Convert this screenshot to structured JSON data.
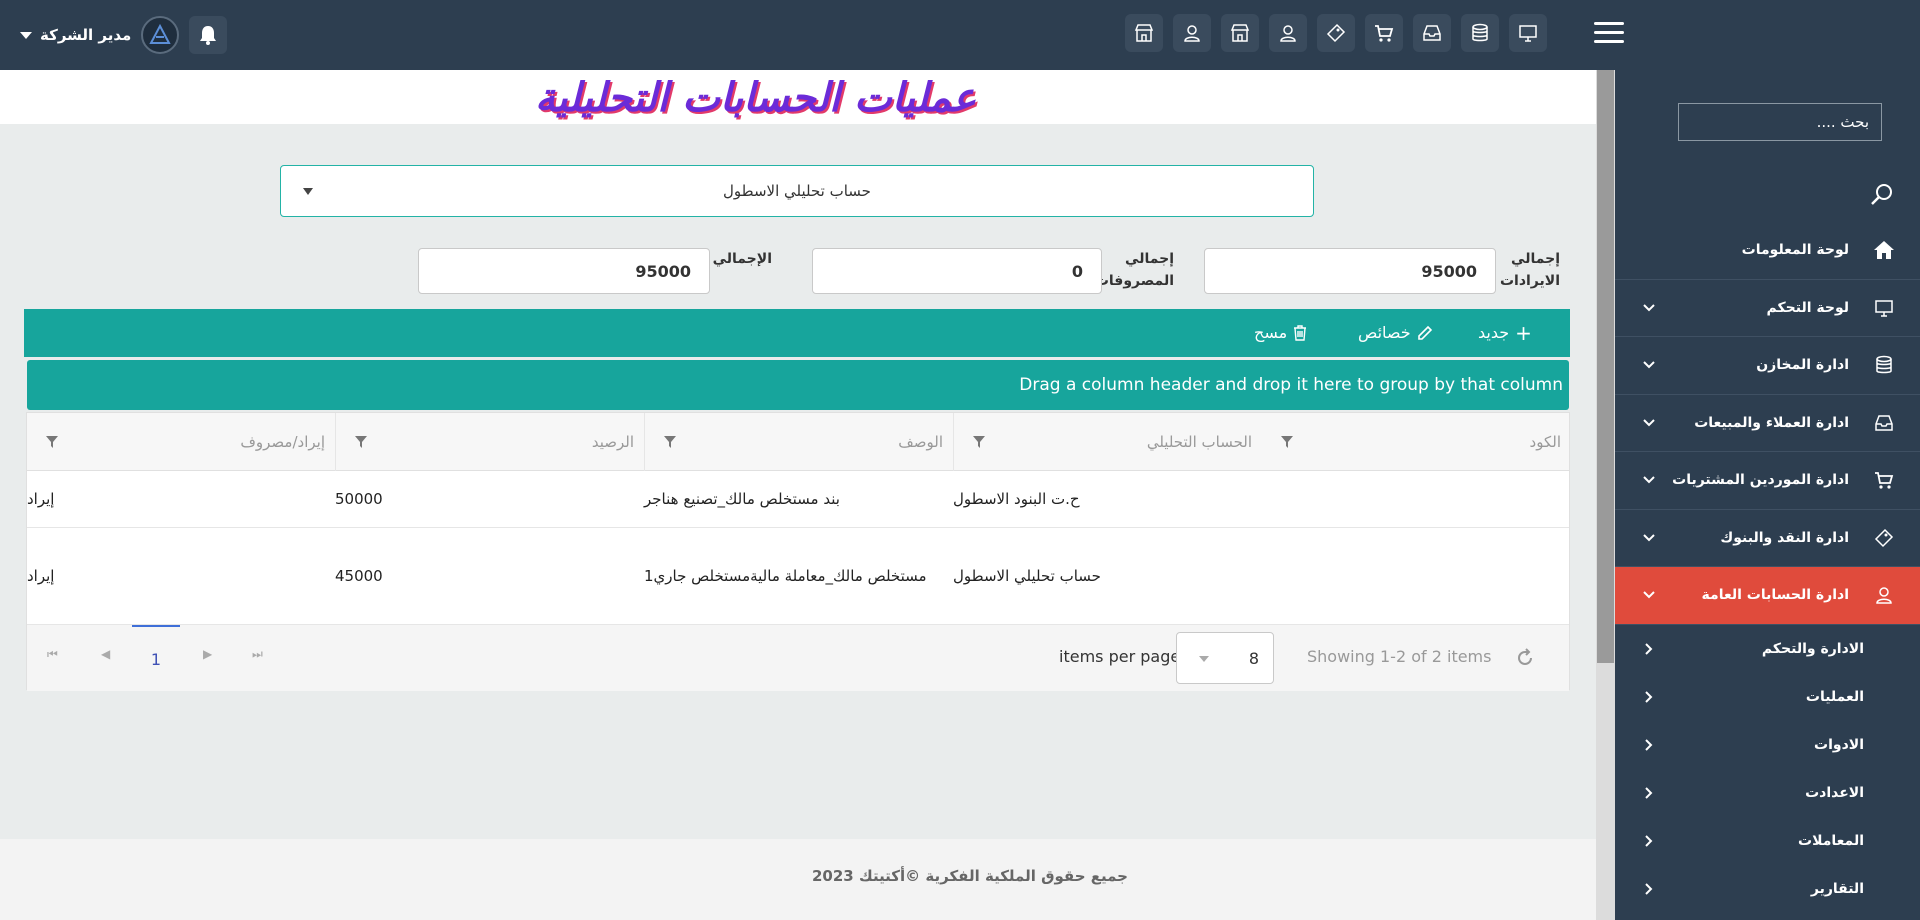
{
  "header": {
    "user_name": "مدير الشركة",
    "icons": [
      "monitor-icon",
      "database-icon",
      "inbox-icon",
      "cart-icon",
      "ticket-icon",
      "user-icon",
      "store-icon",
      "user-icon",
      "store-icon"
    ]
  },
  "sidebar": {
    "search_placeholder": "بحث ....",
    "items": [
      {
        "label": "لوحة المعلومات",
        "icon": "home-icon",
        "expandable": false
      },
      {
        "label": "لوحة التحكم",
        "icon": "monitor-icon",
        "expandable": true
      },
      {
        "label": "ادارة المخازن",
        "icon": "database-icon",
        "expandable": true
      },
      {
        "label": "ادارة العملاء والمبيعات",
        "icon": "inbox-icon",
        "expandable": true
      },
      {
        "label": "ادارة الموردين المشتريات",
        "icon": "cart-icon",
        "expandable": true
      },
      {
        "label": "ادارة النقد والبنوك",
        "icon": "ticket-icon",
        "expandable": true
      },
      {
        "label": "ادارة الحسابات العامة",
        "icon": "user-icon",
        "expandable": true,
        "active": true
      }
    ],
    "subitems": [
      {
        "label": "الادارة والتحكم"
      },
      {
        "label": "العمليات"
      },
      {
        "label": "الادوات"
      },
      {
        "label": "الاعدادت"
      },
      {
        "label": "المعاملات"
      },
      {
        "label": "التقارير"
      }
    ],
    "active_color": "#e04b3c"
  },
  "page": {
    "title": "عمليات الحسابات التحليلية",
    "selected_account": "حساب تحليلي الاسطول"
  },
  "totals": {
    "revenue_label": "إجمالي الايرادات",
    "revenue_value": "95000",
    "expenses_label": "إجمالي المصروفات",
    "expenses_value": "0",
    "total_label": "الإجمالي",
    "total_value": "95000"
  },
  "toolbar": {
    "new_label": "جديد",
    "properties_label": "خصائص",
    "delete_label": "مسح",
    "accent_color": "#17a59c"
  },
  "grid": {
    "group_hint": "Drag a column header and drop it here to group by that column",
    "columns": [
      "الكود",
      "الحساب التحليلي",
      "الوصف",
      "الرصيد",
      "إيراد/مصروف"
    ],
    "rows": [
      {
        "code": "",
        "account": "ح.ت البنود الاسطول",
        "description": "بند مستخلص مالك_تصنيع هناجر",
        "balance": "50000",
        "type": "إيراد"
      },
      {
        "code": "",
        "account": "حساب تحليلي الاسطول",
        "description": "مستخلص مالك_معاملة ماليةمستخلص جاري1",
        "balance": "45000",
        "type": "إيراد"
      }
    ],
    "pager": {
      "current_page": "1",
      "items_per_page": "8",
      "items_per_page_label": "items per page",
      "showing": "Showing 1-2 of 2 items"
    }
  },
  "footer": {
    "text": "جميع حقوق الملكية الفكرية ©أكتيتك 2023"
  }
}
